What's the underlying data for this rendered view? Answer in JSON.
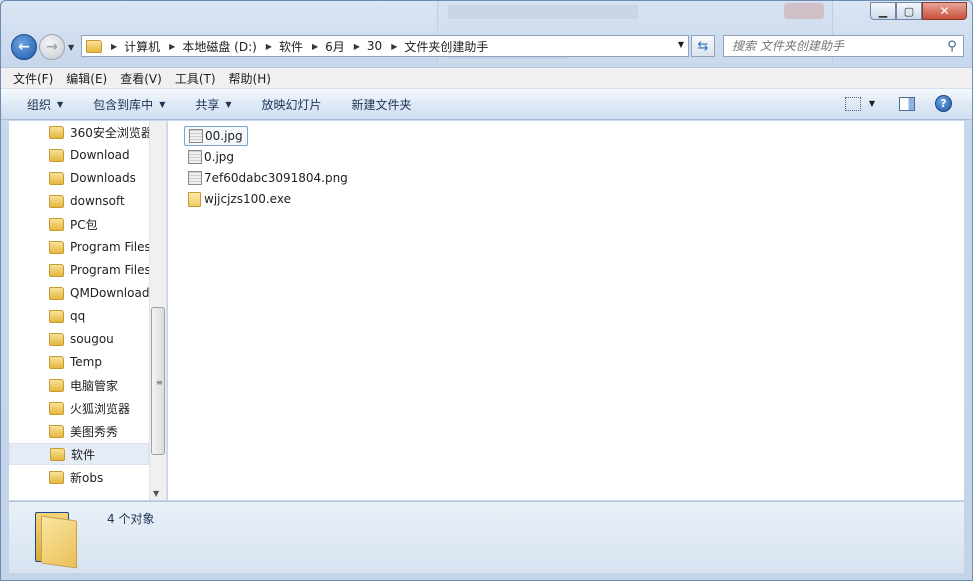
{
  "window": {
    "caption_buttons": {
      "minimize": "▁",
      "maximize": "▢",
      "close": "✕"
    }
  },
  "address": {
    "crumbs": [
      "计算机",
      "本地磁盘 (D:)",
      "软件",
      "6月",
      "30",
      "文件夹创建助手"
    ]
  },
  "search": {
    "placeholder": "搜索 文件夹创建助手"
  },
  "menu": [
    "文件(F)",
    "编辑(E)",
    "查看(V)",
    "工具(T)",
    "帮助(H)"
  ],
  "commands": [
    {
      "label": "组织",
      "dropdown": true
    },
    {
      "label": "包含到库中",
      "dropdown": true
    },
    {
      "label": "共享",
      "dropdown": true
    },
    {
      "label": "放映幻灯片",
      "dropdown": false
    },
    {
      "label": "新建文件夹",
      "dropdown": false
    }
  ],
  "tree": [
    {
      "label": "360安全浏览器"
    },
    {
      "label": "Download"
    },
    {
      "label": "Downloads"
    },
    {
      "label": "downsoft"
    },
    {
      "label": "PC包"
    },
    {
      "label": "Program Files"
    },
    {
      "label": "Program Files"
    },
    {
      "label": "QMDownload"
    },
    {
      "label": "qq"
    },
    {
      "label": "sougou"
    },
    {
      "label": "Temp"
    },
    {
      "label": "电脑管家"
    },
    {
      "label": "火狐浏览器"
    },
    {
      "label": "美图秀秀"
    },
    {
      "label": "软件",
      "selected": true
    },
    {
      "label": "新obs"
    }
  ],
  "files": [
    {
      "name": "00.jpg",
      "icon": "image-file-icon",
      "selected": true
    },
    {
      "name": "0.jpg",
      "icon": "image-file-icon"
    },
    {
      "name": "7ef60dabc3091804.png",
      "icon": "image-file-icon"
    },
    {
      "name": "wjjcjzs100.exe",
      "icon": "exe-file-icon"
    }
  ],
  "details": {
    "count": "4 个对象"
  },
  "icons": {
    "help": "?"
  }
}
